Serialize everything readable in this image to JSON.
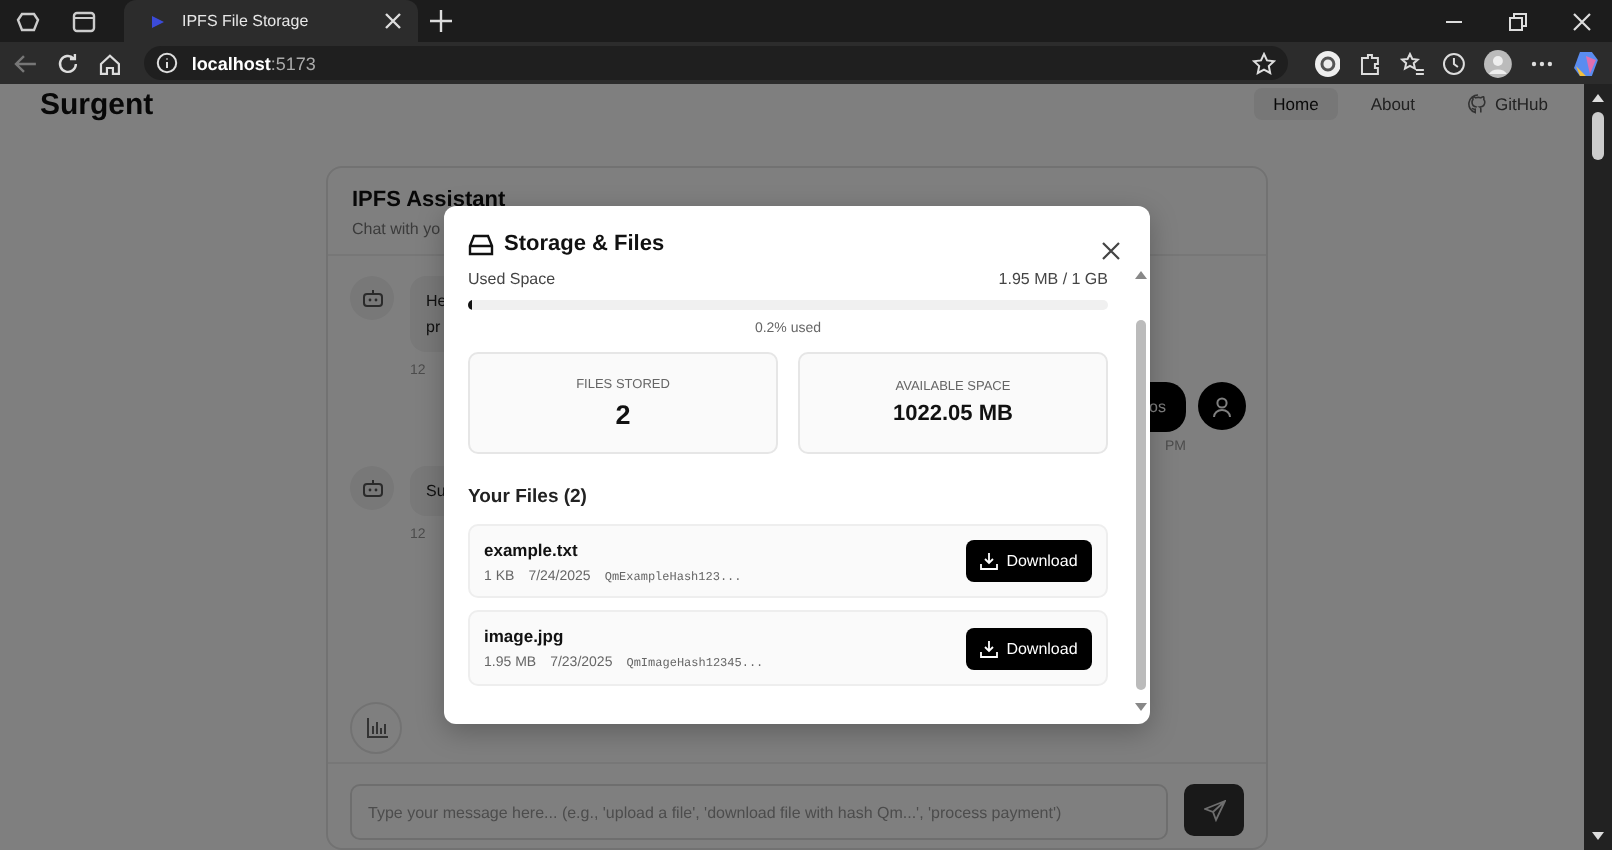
{
  "browser": {
    "tab_title": "IPFS File Storage",
    "url_host": "localhost",
    "url_port": ":5173"
  },
  "page": {
    "brand": "Surgent",
    "nav": [
      {
        "label": "Home",
        "selected": true
      },
      {
        "label": "About",
        "selected": false
      },
      {
        "label": "GitHub",
        "selected": false
      }
    ]
  },
  "chat": {
    "title": "IPFS Assistant",
    "subtitle": "Chat with yo",
    "messages": [
      {
        "kind": "bot",
        "lines": [
          "He",
          "pr"
        ],
        "time": "12"
      },
      {
        "kind": "user",
        "lines": [
          "os"
        ],
        "time": "PM"
      },
      {
        "kind": "bot",
        "lines": [
          "Su"
        ],
        "time": "12"
      }
    ],
    "input": {
      "placeholder": "Type your message here... (e.g., 'upload a file', 'download file with hash Qm...', 'process payment')"
    }
  },
  "modal": {
    "title": "Storage & Files",
    "used_label": "Used Space",
    "used_value": "1.95 MB / 1 GB",
    "usage": {
      "level": 0.002
    },
    "usage_text": "0.2% used",
    "stats": [
      {
        "label": "FILES STORED",
        "value": "2"
      },
      {
        "label": "AVAILABLE SPACE",
        "value": "1022.05 MB"
      }
    ],
    "files_heading": "Your Files (2)",
    "files": [
      {
        "name": "example.txt",
        "size": "1 KB",
        "date": "7/24/2025",
        "hash": "QmExampleHash123...",
        "action": "Download"
      },
      {
        "name": "image.jpg",
        "size": "1.95 MB",
        "date": "7/23/2025",
        "hash": "QmImageHash12345...",
        "action": "Download"
      }
    ]
  }
}
